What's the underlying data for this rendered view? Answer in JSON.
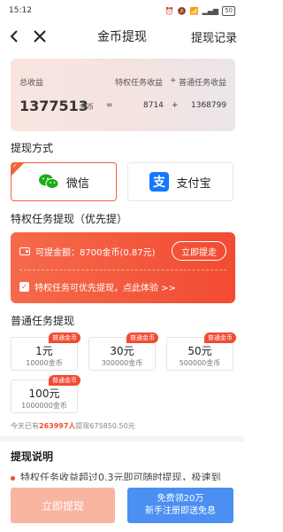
{
  "status": {
    "time": "15:12",
    "battery": "50"
  },
  "nav": {
    "title": "金币提现",
    "right": "提现记录"
  },
  "earnings": {
    "total_label": "总收益",
    "vip_label": "特权任务收益",
    "plus": "+",
    "normal_label": "普通任务收益",
    "total_value": "1377513",
    "unit": "金币",
    "equals": "=",
    "vip_value": "8714",
    "plus2": "+",
    "normal_value": "1368799"
  },
  "method": {
    "title": "提现方式",
    "wechat": "微信",
    "alipay": "支付宝"
  },
  "vip": {
    "title": "特权任务提现（优先提）",
    "available": "可提金额：8700金币(0.87元)",
    "button": "立即提走",
    "tip": "特权任务可优先提现，点此体验 >>"
  },
  "normal": {
    "title": "普通任务提现",
    "options": [
      {
        "main": "1元",
        "sub": "10000金币",
        "badge": "普通金币"
      },
      {
        "main": "30元",
        "sub": "300000金币",
        "badge": "普通金币"
      },
      {
        "main": "50元",
        "sub": "500000金币",
        "badge": "普通金币"
      },
      {
        "main": "100元",
        "sub": "1000000金币",
        "badge": "普通金币"
      }
    ]
  },
  "today": {
    "prefix": "今天已有",
    "count": "263997人",
    "suffix": "提现675850.50元"
  },
  "explain": {
    "title": "提现说明",
    "line1": "特权任务收益超过0.3元即可随时提现，极速到"
  },
  "bottom": {
    "withdraw": "立即提现",
    "free_line1": "免费领20万",
    "free_line2": "新手注册即送免息"
  },
  "colors": {
    "accent": "#f24b32",
    "wechat": "#1aad19",
    "alipay": "#1677ff",
    "blue_btn": "#4b8ff2"
  }
}
